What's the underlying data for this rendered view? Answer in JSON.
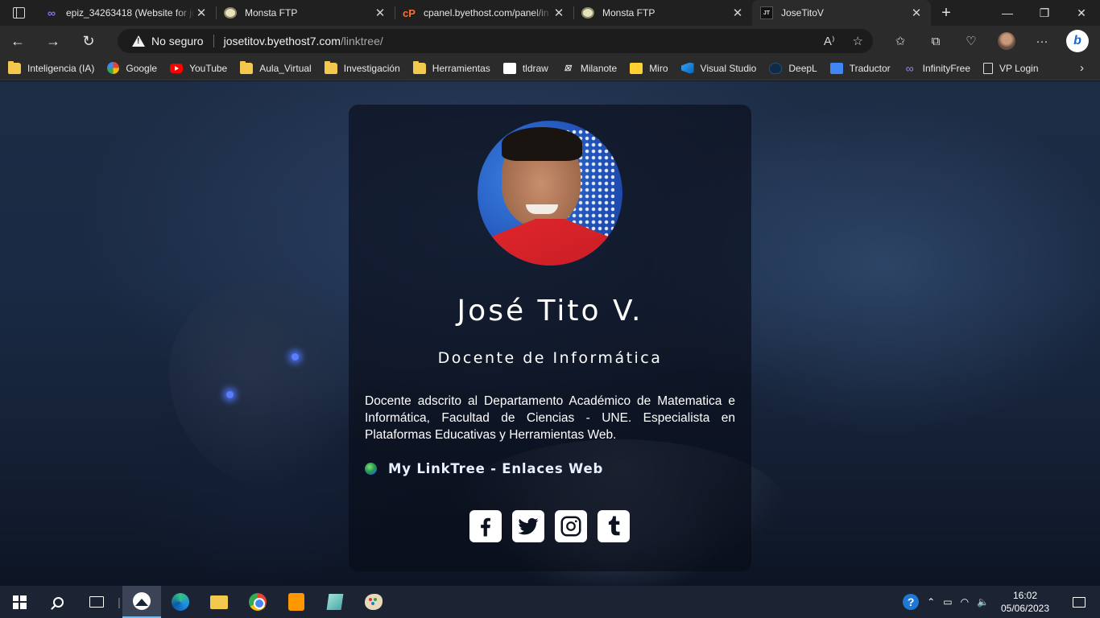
{
  "browser": {
    "tabs": [
      {
        "title": "epiz_34263418 (Website for jo",
        "icon": "infinity-icon"
      },
      {
        "title": "Monsta FTP",
        "icon": "monsta-icon"
      },
      {
        "title": "cpanel.byethost.com/panel/in",
        "icon": "cpanel-icon"
      },
      {
        "title": "Monsta FTP",
        "icon": "monsta-icon"
      },
      {
        "title": "JoseTitoV",
        "icon": "jt-icon",
        "active": true
      }
    ],
    "address": {
      "security_label": "No seguro",
      "host": "josetitov.byethost7.com",
      "path": "/linktree/"
    },
    "bookmarks": [
      {
        "label": "Inteligencia (IA)",
        "icon": "folder-icon"
      },
      {
        "label": "Google",
        "icon": "google-icon"
      },
      {
        "label": "YouTube",
        "icon": "youtube-icon"
      },
      {
        "label": "Aula_Virtual",
        "icon": "folder-icon"
      },
      {
        "label": "Investigación",
        "icon": "folder-icon"
      },
      {
        "label": "Herramientas",
        "icon": "folder-icon"
      },
      {
        "label": "tldraw",
        "icon": "tldraw-icon"
      },
      {
        "label": "Milanote",
        "icon": "milanote-icon"
      },
      {
        "label": "Miro",
        "icon": "miro-icon"
      },
      {
        "label": "Visual Studio",
        "icon": "vscode-icon"
      },
      {
        "label": "DeepL",
        "icon": "deepl-icon"
      },
      {
        "label": "Traductor",
        "icon": "translate-icon"
      },
      {
        "label": "InfinityFree",
        "icon": "infinity-icon"
      },
      {
        "label": "VP Login",
        "icon": "document-icon"
      }
    ]
  },
  "profile": {
    "name": "José Tito V.",
    "role": "Docente de Informática",
    "bio": "Docente adscrito al Departamento Académico de Matematica e Informática, Facultad de Ciencias - UNE. Especialista en Plataformas Educativas y Herramientas Web.",
    "linktree_label": "My LinkTree - Enlaces Web",
    "social": [
      "facebook-icon",
      "twitter-icon",
      "instagram-icon",
      "tumblr-icon"
    ]
  },
  "taskbar": {
    "time": "16:02",
    "date": "05/06/2023"
  },
  "colors": {
    "browser_bg": "#202020",
    "toolbar_bg": "#2b2b2b",
    "card_bg": "rgba(8,12,22,0.62)",
    "taskbar_bg": "#1c2433"
  }
}
